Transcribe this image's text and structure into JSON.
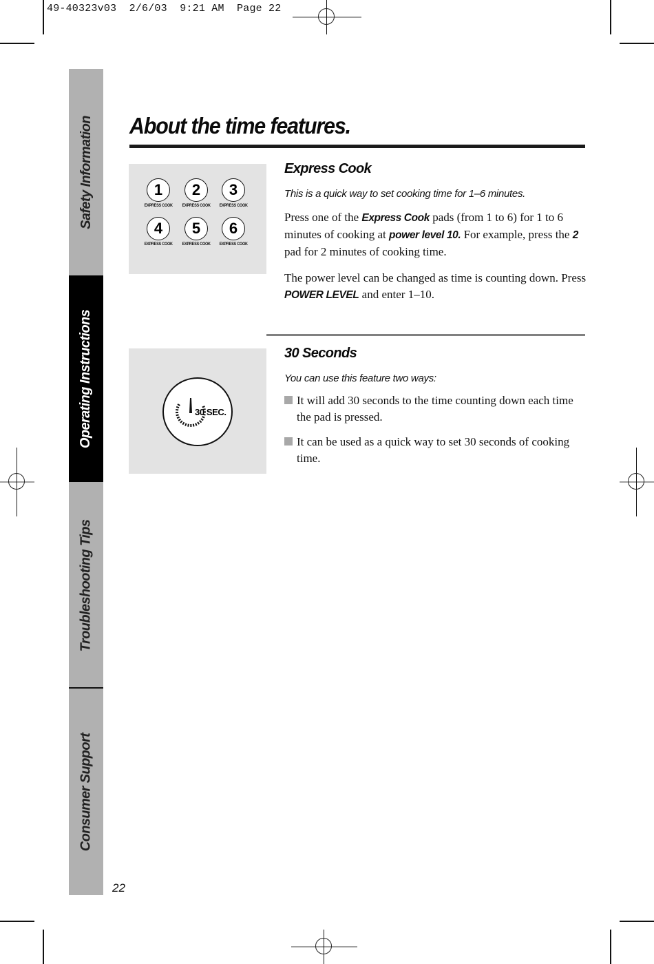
{
  "print_slug": "49-40323v03  2/6/03  9:21 AM  Page 22",
  "sidebar": {
    "tabs": [
      {
        "label": "Safety Information",
        "active": false
      },
      {
        "label": "Operating Instructions",
        "active": true
      },
      {
        "label": "Troubleshooting Tips",
        "active": false
      },
      {
        "label": "Consumer Support",
        "active": false
      }
    ]
  },
  "page_number": "22",
  "page_title": "About the time features.",
  "express_cook": {
    "heading": "Express Cook",
    "lead": "This is a quick way to set cooking time for 1–6 minutes.",
    "para1": {
      "t1": "Press one of the ",
      "b1": "Express Cook",
      "t2": " pads (from 1 to 6) for 1 to 6 minutes of cooking at ",
      "b2": "power level 10.",
      "t3": " For example, press the ",
      "b3": "2",
      "t4": " pad for 2 minutes of cooking time."
    },
    "para2": {
      "t1": "The power level can be changed as time is counting down. Press ",
      "b1": "POWER LEVEL",
      "t2": " and enter 1–10."
    },
    "pads": [
      {
        "number": "1",
        "label": "EXPRESS COOK"
      },
      {
        "number": "2",
        "label": "EXPRESS COOK"
      },
      {
        "number": "3",
        "label": "EXPRESS COOK"
      },
      {
        "number": "4",
        "label": "EXPRESS COOK"
      },
      {
        "number": "5",
        "label": "EXPRESS COOK"
      },
      {
        "number": "6",
        "label": "EXPRESS COOK"
      }
    ]
  },
  "thirty_seconds": {
    "heading": "30 Seconds",
    "lead": "You can use this feature two ways:",
    "button_label": "30 SEC.",
    "bullets": [
      "It will add 30 seconds to the time counting down each time the pad is pressed.",
      "It can be used as a quick way to set 30 seconds of cooking time."
    ]
  }
}
